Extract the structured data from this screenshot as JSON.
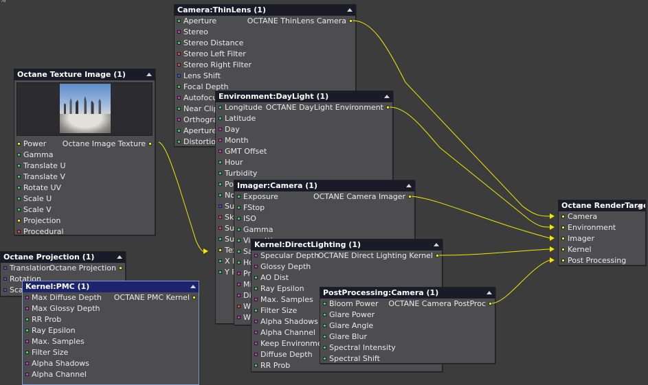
{
  "corner_text": "%",
  "colors": {
    "background": "#3c3c3c",
    "node_body": "#4d4d50",
    "header": "#1a1a28",
    "header_selected": "#1c2470",
    "wire": "#f2e800",
    "port_float": "#38d468",
    "port_int": "#d034c8",
    "port_node": "#e04a3a",
    "port_vector": "#3a50e8",
    "port_texture": "#f2e800"
  },
  "nodes": {
    "camera_thinlens": {
      "title": "Camera:ThinLens (1)",
      "output": "OCTANE ThinLens Camera",
      "rows": [
        {
          "label": "Aperture",
          "port": "c-green"
        },
        {
          "label": "Stereo",
          "port": "c-magenta"
        },
        {
          "label": "Stereo Distance",
          "port": "c-green"
        },
        {
          "label": "Stereo Left Filter",
          "port": "c-red"
        },
        {
          "label": "Stereo Right Filter",
          "port": "c-red"
        },
        {
          "label": "Lens Shift",
          "port": "c-blue"
        },
        {
          "label": "Focal Depth",
          "port": "c-green"
        },
        {
          "label": "Autofocus",
          "port": "c-magenta"
        },
        {
          "label": "Near Clip Depth",
          "port": "c-green"
        },
        {
          "label": "Orthographic",
          "port": "c-magenta"
        },
        {
          "label": "Aperture Edge",
          "port": "c-green"
        },
        {
          "label": "Distortion",
          "port": "c-green"
        }
      ]
    },
    "texture_image": {
      "title": "Octane Texture Image (1)",
      "output": "Octane Image Texture",
      "rows": [
        {
          "label": "Power",
          "port": "c-yellow"
        },
        {
          "label": "Gamma",
          "port": "c-green"
        },
        {
          "label": "Translate U",
          "port": "c-green"
        },
        {
          "label": "Translate V",
          "port": "c-green"
        },
        {
          "label": "Rotate UV",
          "port": "c-green"
        },
        {
          "label": "Scale U",
          "port": "c-green"
        },
        {
          "label": "Scale V",
          "port": "c-green"
        },
        {
          "label": "Projection",
          "port": "c-yellow"
        },
        {
          "label": "Procedural",
          "port": "c-red"
        }
      ]
    },
    "environment_daylight": {
      "title": "Environment:DayLight (1)",
      "output": "OCTANE DayLight Environment",
      "rows": [
        {
          "label": "Longitude",
          "port": "c-green"
        },
        {
          "label": "Latitude",
          "port": "c-green"
        },
        {
          "label": "Day",
          "port": "c-magenta"
        },
        {
          "label": "Month",
          "port": "c-magenta"
        },
        {
          "label": "GMT Offset",
          "port": "c-magenta"
        },
        {
          "label": "Hour",
          "port": "c-green"
        },
        {
          "label": "Turbidity",
          "port": "c-green"
        },
        {
          "label": "Power",
          "port": "c-green"
        },
        {
          "label": "North Offset",
          "port": "c-green"
        },
        {
          "label": "Sun Direction",
          "port": "c-blue"
        },
        {
          "label": "Sky Color",
          "port": "c-red"
        },
        {
          "label": "Sun Color",
          "port": "c-red"
        },
        {
          "label": "Sun Size",
          "port": "c-green"
        },
        {
          "label": "Texture",
          "port": "c-yellow"
        },
        {
          "label": "X Rotation",
          "port": "c-green"
        },
        {
          "label": "Y Rotation",
          "port": "c-green"
        }
      ]
    },
    "imager_camera": {
      "title": "Imager:Camera (1)",
      "output": "OCTANE Camera Imager",
      "rows": [
        {
          "label": "Exposure",
          "port": "c-green"
        },
        {
          "label": "FStop",
          "port": "c-green"
        },
        {
          "label": "ISO",
          "port": "c-green"
        },
        {
          "label": "Gamma",
          "port": "c-green"
        },
        {
          "label": "Vignetting",
          "port": "c-green"
        },
        {
          "label": "Saturation",
          "port": "c-green"
        },
        {
          "label": "Hot Pixel Removal",
          "port": "c-green"
        },
        {
          "label": "Premultiplied Alpha",
          "port": "c-magenta"
        },
        {
          "label": "Min Display Samples",
          "port": "c-magenta"
        },
        {
          "label": "Dithering",
          "port": "c-magenta"
        },
        {
          "label": "White Balance",
          "port": "c-red"
        },
        {
          "label": "White Saturation",
          "port": "c-magenta"
        }
      ]
    },
    "kernel_directlighting": {
      "title": "Kernel:DirectLighting (1)",
      "output": "OCTANE Direct Lighting Kernel",
      "rows": [
        {
          "label": "Specular Depth",
          "port": "c-magenta"
        },
        {
          "label": "Glossy Depth",
          "port": "c-magenta"
        },
        {
          "label": "AO Dist",
          "port": "c-green"
        },
        {
          "label": "Ray Epsilon",
          "port": "c-green"
        },
        {
          "label": "Max. Samples",
          "port": "c-magenta"
        },
        {
          "label": "Filter Size",
          "port": "c-green"
        },
        {
          "label": "Alpha Shadows",
          "port": "c-magenta"
        },
        {
          "label": "Alpha Channel",
          "port": "c-magenta"
        },
        {
          "label": "Keep Environment",
          "port": "c-magenta"
        },
        {
          "label": "Diffuse Depth",
          "port": "c-magenta"
        },
        {
          "label": "RR Prob",
          "port": "c-green"
        }
      ]
    },
    "postprocessing_camera": {
      "title": "PostProcessing:Camera (1)",
      "output": "OCTANE Camera PostProc",
      "rows": [
        {
          "label": "Bloom Power",
          "port": "c-green"
        },
        {
          "label": "Glare Power",
          "port": "c-green"
        },
        {
          "label": "Glare Angle",
          "port": "c-green"
        },
        {
          "label": "Glare Blur",
          "port": "c-green"
        },
        {
          "label": "Spectral Intensity",
          "port": "c-green"
        },
        {
          "label": "Spectral Shift",
          "port": "c-green"
        }
      ]
    },
    "projection": {
      "title": "Octane Projection (1)",
      "output": "Octane Projection",
      "rows": [
        {
          "label": "Translation",
          "port": "c-blue"
        },
        {
          "label": "Rotation",
          "port": "c-blue"
        },
        {
          "label": "Scale",
          "port": "c-blue"
        }
      ]
    },
    "kernel_pmc": {
      "title": "Kernel:PMC (1)",
      "output": "OCTANE PMC Kernel",
      "rows": [
        {
          "label": "Max Diffuse Depth",
          "port": "c-magenta"
        },
        {
          "label": "Max Glossy Depth",
          "port": "c-magenta"
        },
        {
          "label": "RR Prob",
          "port": "c-green"
        },
        {
          "label": "Ray Epsilon",
          "port": "c-green"
        },
        {
          "label": "Max. Samples",
          "port": "c-magenta"
        },
        {
          "label": "Filter Size",
          "port": "c-green"
        },
        {
          "label": "Alpha Shadows",
          "port": "c-magenta"
        },
        {
          "label": "Alpha Channel",
          "port": "c-magenta"
        }
      ]
    },
    "render_target": {
      "title": "Octane RenderTarget",
      "rows": [
        {
          "label": "Camera",
          "port": "c-yellow"
        },
        {
          "label": "Environment",
          "port": "c-yellow"
        },
        {
          "label": "Imager",
          "port": "c-yellow"
        },
        {
          "label": "Kernel",
          "port": "c-yellow"
        },
        {
          "label": "Post Processing",
          "port": "c-yellow"
        }
      ]
    }
  }
}
